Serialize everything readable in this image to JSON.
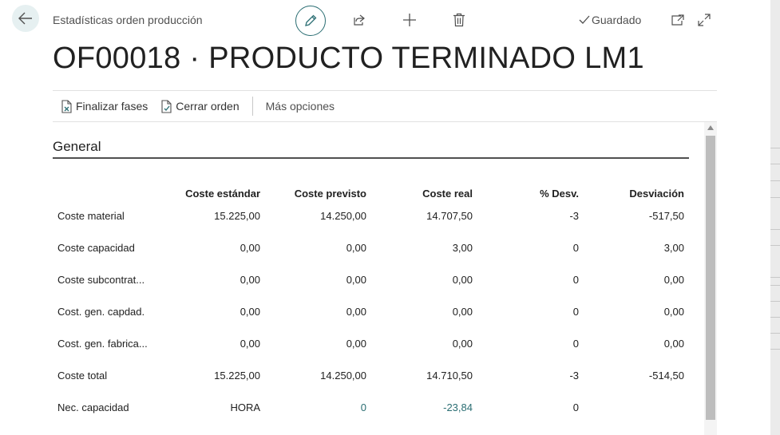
{
  "header": {
    "caption": "Estadísticas orden producción",
    "title": "OF00018 · PRODUCTO TERMINADO LM1",
    "saved_label": "Guardado"
  },
  "icons": {
    "back": "arrow-left-icon",
    "edit": "pencil-icon",
    "share": "share-icon",
    "new": "plus-icon",
    "delete": "trash-icon",
    "saved": "checkmark-icon",
    "open_new_window": "open-in-new-window-icon",
    "expand": "expand-icon"
  },
  "actions": {
    "finish_phases": "Finalizar fases",
    "close_order": "Cerrar orden",
    "more_options": "Más opciones"
  },
  "section": {
    "title": "General"
  },
  "table": {
    "columns": [
      "Coste estándar",
      "Coste previsto",
      "Coste real",
      "% Desv.",
      "Desviación"
    ],
    "rows": [
      {
        "label": "Coste material",
        "values": [
          "15.225,00",
          "14.250,00",
          "14.707,50",
          "-3",
          "-517,50"
        ]
      },
      {
        "label": "Coste capacidad",
        "values": [
          "0,00",
          "0,00",
          "3,00",
          "0",
          "3,00"
        ]
      },
      {
        "label": "Coste subcontrat...",
        "values": [
          "0,00",
          "0,00",
          "0,00",
          "0",
          "0,00"
        ]
      },
      {
        "label": "Cost. gen. capdad.",
        "values": [
          "0,00",
          "0,00",
          "0,00",
          "0",
          "0,00"
        ]
      },
      {
        "label": "Cost. gen. fabrica...",
        "values": [
          "0,00",
          "0,00",
          "0,00",
          "0",
          "0,00"
        ]
      },
      {
        "label": "Coste total",
        "values": [
          "15.225,00",
          "14.250,00",
          "14.710,50",
          "-3",
          "-514,50"
        ]
      },
      {
        "label": "Nec. capacidad",
        "values": [
          "HORA",
          "0",
          "-23,84",
          "0"
        ]
      }
    ]
  },
  "colors": {
    "accent": "#2b6e73",
    "back_button_bg": "#e6f0f1",
    "text": "#212121"
  }
}
